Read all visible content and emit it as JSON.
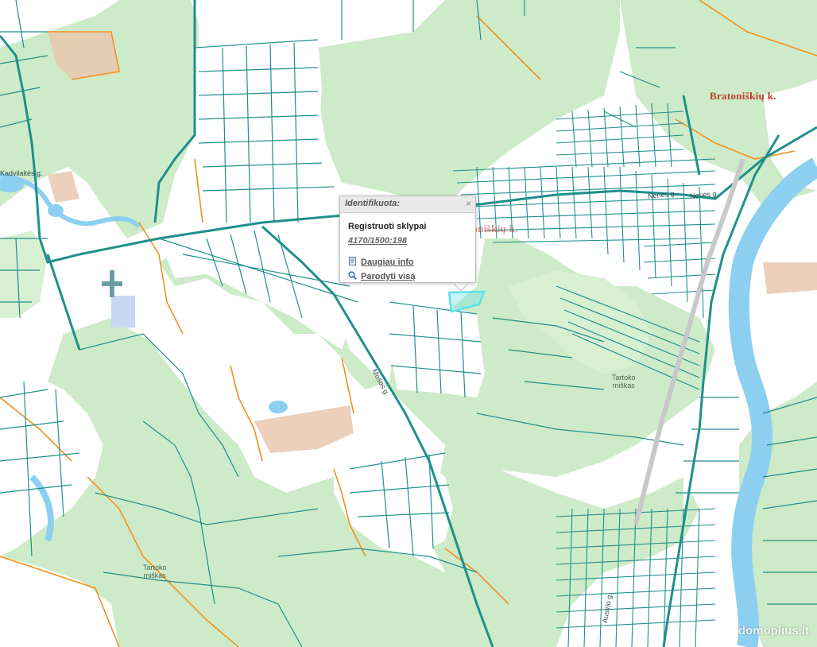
{
  "map": {
    "colors": {
      "background": "#ffffff",
      "forest": "#cdebc8",
      "forest_light": "#d8f0d2",
      "parcel_border": "#1f8f8c",
      "road": "#1f8f8c",
      "boundary": "#f0901f",
      "water": "#8ccff0",
      "highlight": "#5fe0ee",
      "village_label": "#c0392b"
    },
    "village_labels": {
      "bratoniskiu_top": "Bratoniškių k.",
      "bratoniskiu_mid": "Bratoniškių k."
    },
    "street_labels": {
      "kadvilaites": "Kadvilaitės g.",
      "neries_1": "Neries g.",
      "neries_2": "Neries g.",
      "mostiko": "Mošos g.",
      "austrio": "Austrio g."
    },
    "forest_labels": {
      "tartoko_east": "Tartoko\nmiškas",
      "tartoko_south": "Tartoko\nmiškas"
    }
  },
  "popup": {
    "title": "Identifikuota:",
    "close": "×",
    "layer": "Registruoti sklypai",
    "parcel_id": "4170/1500:198",
    "more_info": "Daugiau info",
    "show_all": "Parodyti visą"
  },
  "watermark": "domoplius.lt"
}
